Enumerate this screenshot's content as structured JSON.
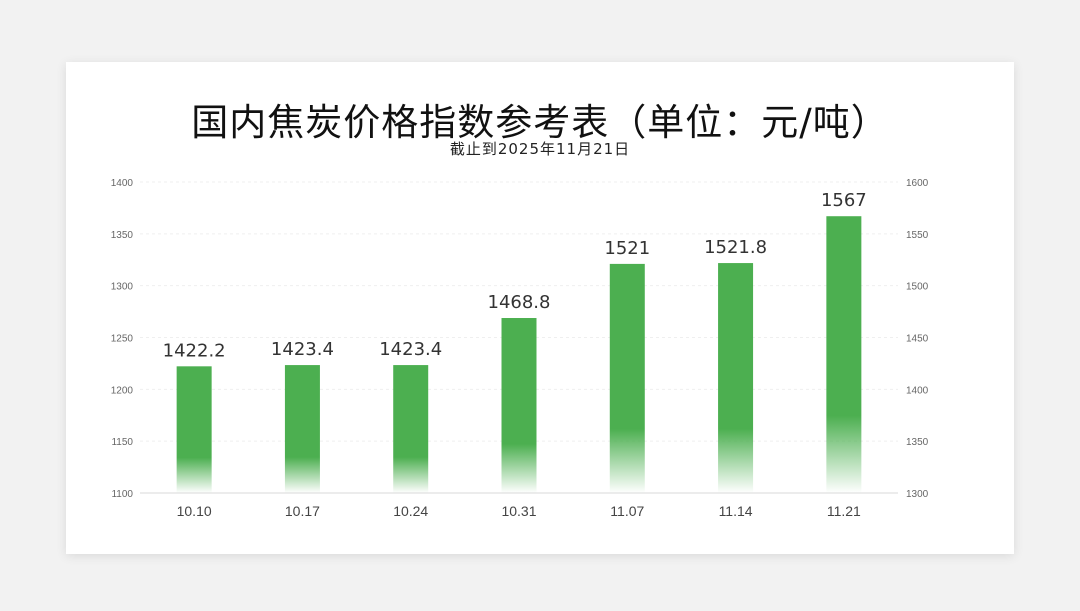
{
  "title": "国内焦炭价格指数参考表（单位：元/吨）",
  "subtitle": "截止到2025年11月21日",
  "colors": {
    "bar": "#4caf50",
    "background": "#ffffff"
  },
  "chart_data": {
    "type": "bar",
    "categories": [
      "10.10",
      "10.17",
      "10.24",
      "10.31",
      "11.07",
      "11.14",
      "11.21"
    ],
    "values": [
      1422.2,
      1423.4,
      1423.4,
      1468.8,
      1521,
      1521.8,
      1567
    ],
    "value_labels": [
      "1422.2",
      "1423.4",
      "1423.4",
      "1468.8",
      "1521",
      "1521.8",
      "1567"
    ],
    "y_axis_left": {
      "ylim": [
        1100,
        1400
      ],
      "ticks": [
        "1100",
        "1150",
        "1200",
        "1250",
        "1300",
        "1350",
        "1400"
      ]
    },
    "y_axis_right": {
      "ylim": [
        1300,
        1600
      ],
      "ticks": [
        "1300",
        "1350",
        "1400",
        "1450",
        "1500",
        "1550",
        "1600"
      ]
    },
    "plotted_against": "right",
    "grid": true,
    "legend": "none"
  }
}
